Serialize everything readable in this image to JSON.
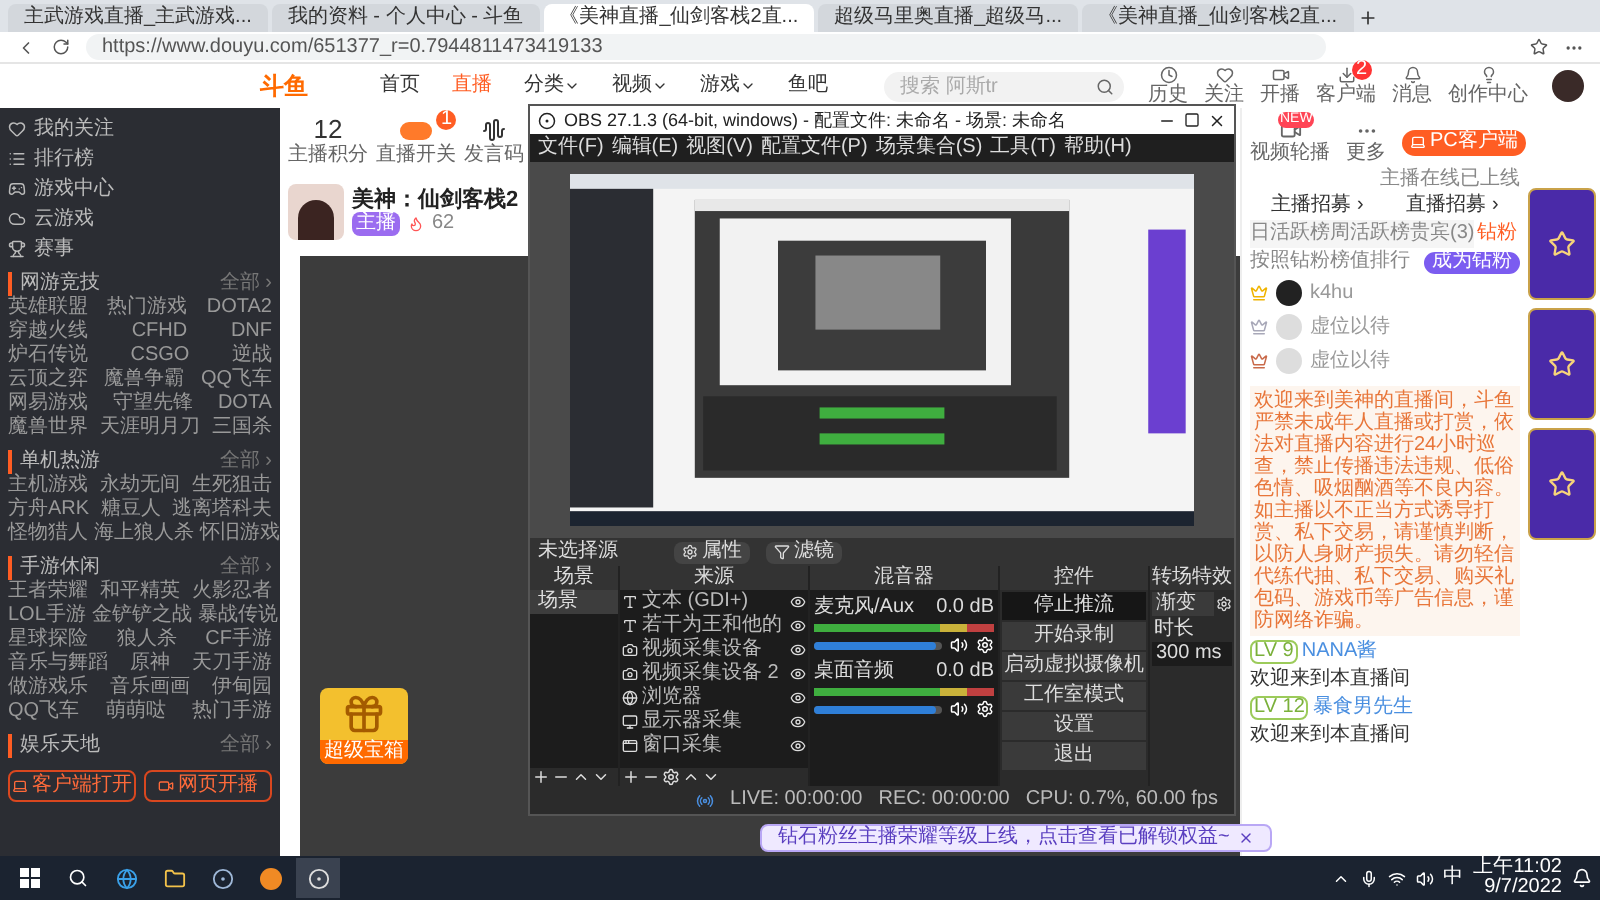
{
  "browser": {
    "tabs": [
      {
        "title": "主武游戏直播_主武游戏...",
        "selected": false
      },
      {
        "title": "我的资料 - 个人中心 - 斗鱼",
        "selected": false
      },
      {
        "title": "《美神直播_仙剑客栈2直...",
        "selected": true
      },
      {
        "title": "超级马里奥直播_超级马...",
        "selected": false
      },
      {
        "title": "《美神直播_仙剑客栈2直...",
        "selected": false
      }
    ],
    "address": "https://www.douyu.com/651377_r=0.7944811473419133"
  },
  "site_header": {
    "logo": "斗鱼",
    "nav": [
      {
        "label": "首页",
        "selected": false,
        "dropdown": false
      },
      {
        "label": "直播",
        "selected": true,
        "dropdown": false
      },
      {
        "label": "分类",
        "selected": false,
        "dropdown": true
      },
      {
        "label": "视频",
        "selected": false,
        "dropdown": true
      },
      {
        "label": "游戏",
        "selected": false,
        "dropdown": true
      },
      {
        "label": "鱼吧",
        "selected": false,
        "dropdown": false
      }
    ],
    "search": {
      "placeholder": "搜索 阿斯tr"
    },
    "actions": [
      {
        "label": "历史",
        "kind": "clock"
      },
      {
        "label": "关注",
        "kind": "heart"
      },
      {
        "label": "开播",
        "kind": "video"
      },
      {
        "label": "客户端",
        "kind": "download",
        "badge": "2"
      },
      {
        "label": "消息",
        "kind": "bell"
      },
      {
        "label": "创作中心",
        "kind": "bulb"
      }
    ]
  },
  "sidebar": {
    "items": [
      {
        "label": "我的关注",
        "kind": "heart"
      },
      {
        "label": "排行榜",
        "kind": "list"
      },
      {
        "label": "游戏中心",
        "kind": "gamepad"
      },
      {
        "label": "云游戏",
        "kind": "cloud"
      },
      {
        "label": "赛事",
        "kind": "trophy"
      }
    ],
    "sections": [
      {
        "title": "网游竞技",
        "more": "全部 ›",
        "rows": [
          [
            "英雄联盟",
            "热门游戏",
            "DOTA2"
          ],
          [
            "穿越火线",
            "CFHD",
            "DNF"
          ],
          [
            "炉石传说",
            "CSGO",
            "逆战"
          ],
          [
            "云顶之弈",
            "魔兽争霸",
            "QQ飞车"
          ],
          [
            "网易游戏",
            "守望先锋",
            "DOTA"
          ],
          [
            "魔兽世界",
            "天涯明月刀",
            "三国杀"
          ]
        ]
      },
      {
        "title": "单机热游",
        "more": "全部 ›",
        "rows": [
          [
            "主机游戏",
            "永劫无间",
            "生死狙击"
          ],
          [
            "方舟ARK",
            "糖豆人",
            "逃离塔科夫"
          ],
          [
            "怪物猎人",
            "海上狼人杀",
            "怀旧游戏"
          ]
        ]
      },
      {
        "title": "手游休闲",
        "more": "全部 ›",
        "rows": [
          [
            "王者荣耀",
            "和平精英",
            "火影忍者"
          ],
          [
            "LOL手游",
            "金铲铲之战",
            "暴战传说"
          ],
          [
            "星球探险",
            "狼人杀",
            "CF手游"
          ],
          [
            "音乐与舞蹈",
            "原神",
            "天刀手游"
          ],
          [
            "做游戏乐",
            "音乐画画",
            "伊甸园"
          ],
          [
            "QQ飞车",
            "萌萌哒",
            "热门手游"
          ]
        ]
      },
      {
        "title": "娱乐天地",
        "more": "全部 ›"
      }
    ],
    "buttons": [
      {
        "label": "客户端打开",
        "kind": "client"
      },
      {
        "label": "网页开播",
        "kind": "web"
      }
    ]
  },
  "stream": {
    "stats": [
      {
        "kind": "score",
        "value": "12",
        "label": "主播积分"
      },
      {
        "kind": "switch",
        "label": "直播开关",
        "badge": "1"
      },
      {
        "kind": "wave",
        "label": "发言码"
      }
    ],
    "streamer": {
      "name": "美神：仙剑客栈2",
      "tag": "主播",
      "hot": "62"
    },
    "chest": {
      "label": "超级宝箱"
    }
  },
  "obs": {
    "title": "OBS 27.1.3 (64-bit, windows) - 配置文件: 未命名 - 场景: 未命名",
    "menu": [
      "文件(F)",
      "编辑(E)",
      "视图(V)",
      "配置文件(P)",
      "场景集合(S)",
      "工具(T)",
      "帮助(H)"
    ],
    "source_toolbar": {
      "status": "未选择源",
      "buttons": [
        {
          "label": "属性",
          "kind": "gear"
        },
        {
          "label": "滤镜",
          "kind": "filter"
        }
      ]
    },
    "scenes": {
      "title": "场景",
      "items": [
        {
          "name": "场景",
          "selected": true
        }
      ]
    },
    "sources": {
      "title": "来源",
      "items": [
        {
          "name": "文本 (GDI+)",
          "kind": "text"
        },
        {
          "name": "若干为王和他的",
          "kind": "text"
        },
        {
          "name": "视频采集设备",
          "kind": "camera"
        },
        {
          "name": "视频采集设备 2",
          "kind": "camera"
        },
        {
          "name": "浏览器",
          "kind": "browser"
        },
        {
          "name": "显示器采集",
          "kind": "display"
        },
        {
          "name": "窗口采集",
          "kind": "window"
        }
      ]
    },
    "mixer": {
      "title": "混音器",
      "channels": [
        {
          "name": "麦克风/Aux",
          "reading": "0.0 dB",
          "level": 0.96
        },
        {
          "name": "桌面音频",
          "reading": "0.0 dB",
          "level": 0.96
        }
      ]
    },
    "controls": {
      "title": "控件",
      "buttons": [
        {
          "label": "停止推流",
          "active": true
        },
        {
          "label": "开始录制",
          "active": false
        },
        {
          "label": "启动虚拟摄像机",
          "active": false
        },
        {
          "label": "工作室模式",
          "active": false
        },
        {
          "label": "设置",
          "active": false
        },
        {
          "label": "退出",
          "active": false
        }
      ]
    },
    "transitions": {
      "title": "转场特效",
      "effect": "渐变",
      "duration_label": "时长",
      "duration": "300 ms"
    },
    "status": {
      "live": "LIVE: 00:00:00",
      "rec": "REC: 00:00:00",
      "cpu": "CPU: 0.7%, 60.00 fps"
    }
  },
  "right_panel": {
    "actions": [
      {
        "label": "视频轮播",
        "badge": "NEW"
      },
      {
        "label": "更多"
      }
    ],
    "pc_button": "PC客户端",
    "pc_caption": "主播在线已上线",
    "recruit": [
      "主播招募 ›",
      "直播招募 ›"
    ],
    "tabs": [
      {
        "label": "日活跃榜",
        "selected": false
      },
      {
        "label": "周活跃榜",
        "selected": false
      },
      {
        "label": "贵宾(3)",
        "selected": false
      },
      {
        "label": "钻粉",
        "selected": true
      }
    ],
    "rank_caption": "按照钻粉榜值排行",
    "join_button": "成为钻粉",
    "ranks": [
      {
        "name": "k4hu",
        "color": "#f0b400",
        "occupied": true
      },
      {
        "name": "虚位以待",
        "color": "#a8a8b8",
        "occupied": false
      },
      {
        "name": "虚位以待",
        "color": "#c96a4a",
        "occupied": false
      }
    ],
    "notice": "欢迎来到美神的直播间，斗鱼严禁未成年人直播或打赏，依法对直播内容进行24小时巡查，禁止传播违法违规、低俗色情、吸烟酗酒等不良内容。如主播以不正当方式诱导打赏、私下交易，请谨慎判断，以防人身财产损失。请勿轻信代练代抽、私下交易、购买礼包码、游戏币等广告信息，谨防网络诈骗。",
    "messages": [
      {
        "level": "LV 9",
        "user": "NANA酱",
        "text": "欢迎来到本直播间"
      },
      {
        "level": "LV 12",
        "user": "暴食男先生",
        "text": "欢迎来到本直播间"
      }
    ]
  },
  "toast": "钻石粉丝主播荣耀等级上线，点击查看已解锁权益~",
  "taskbar": {
    "apps": [
      {
        "kind": "start",
        "active": false
      },
      {
        "kind": "search",
        "active": false
      },
      {
        "kind": "edge",
        "active": false
      },
      {
        "kind": "explorer",
        "active": false
      },
      {
        "kind": "steam",
        "active": false
      },
      {
        "kind": "browser",
        "active": false
      },
      {
        "kind": "obs",
        "active": true
      }
    ],
    "ime": "中",
    "time": "上午11:02",
    "date": "9/7/2022"
  }
}
